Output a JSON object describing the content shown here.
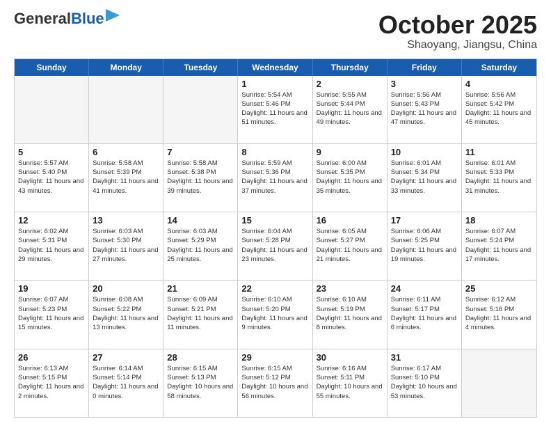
{
  "header": {
    "logo_general": "General",
    "logo_blue": "Blue",
    "title": "October 2025",
    "subtitle": "Shaoyang, Jiangsu, China"
  },
  "days_of_week": [
    "Sunday",
    "Monday",
    "Tuesday",
    "Wednesday",
    "Thursday",
    "Friday",
    "Saturday"
  ],
  "weeks": [
    [
      {
        "day": "",
        "sunrise": "",
        "sunset": "",
        "daylight": "",
        "empty": true
      },
      {
        "day": "",
        "sunrise": "",
        "sunset": "",
        "daylight": "",
        "empty": true
      },
      {
        "day": "",
        "sunrise": "",
        "sunset": "",
        "daylight": "",
        "empty": true
      },
      {
        "day": "1",
        "sunrise": "Sunrise: 5:54 AM",
        "sunset": "Sunset: 5:46 PM",
        "daylight": "Daylight: 11 hours and 51 minutes.",
        "empty": false
      },
      {
        "day": "2",
        "sunrise": "Sunrise: 5:55 AM",
        "sunset": "Sunset: 5:44 PM",
        "daylight": "Daylight: 11 hours and 49 minutes.",
        "empty": false
      },
      {
        "day": "3",
        "sunrise": "Sunrise: 5:56 AM",
        "sunset": "Sunset: 5:43 PM",
        "daylight": "Daylight: 11 hours and 47 minutes.",
        "empty": false
      },
      {
        "day": "4",
        "sunrise": "Sunrise: 5:56 AM",
        "sunset": "Sunset: 5:42 PM",
        "daylight": "Daylight: 11 hours and 45 minutes.",
        "empty": false
      }
    ],
    [
      {
        "day": "5",
        "sunrise": "Sunrise: 5:57 AM",
        "sunset": "Sunset: 5:40 PM",
        "daylight": "Daylight: 11 hours and 43 minutes.",
        "empty": false
      },
      {
        "day": "6",
        "sunrise": "Sunrise: 5:58 AM",
        "sunset": "Sunset: 5:39 PM",
        "daylight": "Daylight: 11 hours and 41 minutes.",
        "empty": false
      },
      {
        "day": "7",
        "sunrise": "Sunrise: 5:58 AM",
        "sunset": "Sunset: 5:38 PM",
        "daylight": "Daylight: 11 hours and 39 minutes.",
        "empty": false
      },
      {
        "day": "8",
        "sunrise": "Sunrise: 5:59 AM",
        "sunset": "Sunset: 5:36 PM",
        "daylight": "Daylight: 11 hours and 37 minutes.",
        "empty": false
      },
      {
        "day": "9",
        "sunrise": "Sunrise: 6:00 AM",
        "sunset": "Sunset: 5:35 PM",
        "daylight": "Daylight: 11 hours and 35 minutes.",
        "empty": false
      },
      {
        "day": "10",
        "sunrise": "Sunrise: 6:01 AM",
        "sunset": "Sunset: 5:34 PM",
        "daylight": "Daylight: 11 hours and 33 minutes.",
        "empty": false
      },
      {
        "day": "11",
        "sunrise": "Sunrise: 6:01 AM",
        "sunset": "Sunset: 5:33 PM",
        "daylight": "Daylight: 11 hours and 31 minutes.",
        "empty": false
      }
    ],
    [
      {
        "day": "12",
        "sunrise": "Sunrise: 6:02 AM",
        "sunset": "Sunset: 5:31 PM",
        "daylight": "Daylight: 11 hours and 29 minutes.",
        "empty": false
      },
      {
        "day": "13",
        "sunrise": "Sunrise: 6:03 AM",
        "sunset": "Sunset: 5:30 PM",
        "daylight": "Daylight: 11 hours and 27 minutes.",
        "empty": false
      },
      {
        "day": "14",
        "sunrise": "Sunrise: 6:03 AM",
        "sunset": "Sunset: 5:29 PM",
        "daylight": "Daylight: 11 hours and 25 minutes.",
        "empty": false
      },
      {
        "day": "15",
        "sunrise": "Sunrise: 6:04 AM",
        "sunset": "Sunset: 5:28 PM",
        "daylight": "Daylight: 11 hours and 23 minutes.",
        "empty": false
      },
      {
        "day": "16",
        "sunrise": "Sunrise: 6:05 AM",
        "sunset": "Sunset: 5:27 PM",
        "daylight": "Daylight: 11 hours and 21 minutes.",
        "empty": false
      },
      {
        "day": "17",
        "sunrise": "Sunrise: 6:06 AM",
        "sunset": "Sunset: 5:25 PM",
        "daylight": "Daylight: 11 hours and 19 minutes.",
        "empty": false
      },
      {
        "day": "18",
        "sunrise": "Sunrise: 6:07 AM",
        "sunset": "Sunset: 5:24 PM",
        "daylight": "Daylight: 11 hours and 17 minutes.",
        "empty": false
      }
    ],
    [
      {
        "day": "19",
        "sunrise": "Sunrise: 6:07 AM",
        "sunset": "Sunset: 5:23 PM",
        "daylight": "Daylight: 11 hours and 15 minutes.",
        "empty": false
      },
      {
        "day": "20",
        "sunrise": "Sunrise: 6:08 AM",
        "sunset": "Sunset: 5:22 PM",
        "daylight": "Daylight: 11 hours and 13 minutes.",
        "empty": false
      },
      {
        "day": "21",
        "sunrise": "Sunrise: 6:09 AM",
        "sunset": "Sunset: 5:21 PM",
        "daylight": "Daylight: 11 hours and 11 minutes.",
        "empty": false
      },
      {
        "day": "22",
        "sunrise": "Sunrise: 6:10 AM",
        "sunset": "Sunset: 5:20 PM",
        "daylight": "Daylight: 11 hours and 9 minutes.",
        "empty": false
      },
      {
        "day": "23",
        "sunrise": "Sunrise: 6:10 AM",
        "sunset": "Sunset: 5:19 PM",
        "daylight": "Daylight: 11 hours and 8 minutes.",
        "empty": false
      },
      {
        "day": "24",
        "sunrise": "Sunrise: 6:11 AM",
        "sunset": "Sunset: 5:17 PM",
        "daylight": "Daylight: 11 hours and 6 minutes.",
        "empty": false
      },
      {
        "day": "25",
        "sunrise": "Sunrise: 6:12 AM",
        "sunset": "Sunset: 5:16 PM",
        "daylight": "Daylight: 11 hours and 4 minutes.",
        "empty": false
      }
    ],
    [
      {
        "day": "26",
        "sunrise": "Sunrise: 6:13 AM",
        "sunset": "Sunset: 5:15 PM",
        "daylight": "Daylight: 11 hours and 2 minutes.",
        "empty": false
      },
      {
        "day": "27",
        "sunrise": "Sunrise: 6:14 AM",
        "sunset": "Sunset: 5:14 PM",
        "daylight": "Daylight: 11 hours and 0 minutes.",
        "empty": false
      },
      {
        "day": "28",
        "sunrise": "Sunrise: 6:15 AM",
        "sunset": "Sunset: 5:13 PM",
        "daylight": "Daylight: 10 hours and 58 minutes.",
        "empty": false
      },
      {
        "day": "29",
        "sunrise": "Sunrise: 6:15 AM",
        "sunset": "Sunset: 5:12 PM",
        "daylight": "Daylight: 10 hours and 56 minutes.",
        "empty": false
      },
      {
        "day": "30",
        "sunrise": "Sunrise: 6:16 AM",
        "sunset": "Sunset: 5:11 PM",
        "daylight": "Daylight: 10 hours and 55 minutes.",
        "empty": false
      },
      {
        "day": "31",
        "sunrise": "Sunrise: 6:17 AM",
        "sunset": "Sunset: 5:10 PM",
        "daylight": "Daylight: 10 hours and 53 minutes.",
        "empty": false
      },
      {
        "day": "",
        "sunrise": "",
        "sunset": "",
        "daylight": "",
        "empty": true
      }
    ]
  ]
}
